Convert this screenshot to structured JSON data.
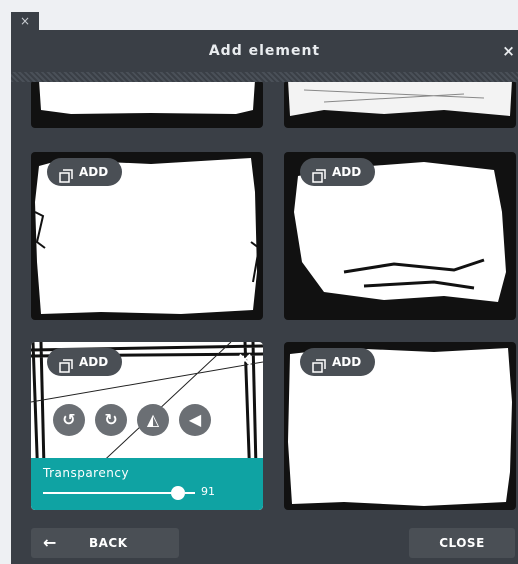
{
  "window": {
    "outer_close_icon": "×",
    "title": "Add element",
    "close_icon": "×"
  },
  "tiles": [
    {
      "add_label": "ADD"
    },
    {
      "add_label": "ADD"
    },
    {
      "add_label": "ADD",
      "selected": true,
      "close_icon": "✕"
    },
    {
      "add_label": "ADD"
    }
  ],
  "selected_tools": [
    {
      "icon": "rotate-left-icon",
      "glyph": "↺"
    },
    {
      "icon": "rotate-right-icon",
      "glyph": "↻"
    },
    {
      "icon": "flip-horizontal-icon",
      "glyph": "◭"
    },
    {
      "icon": "flip-vertical-icon",
      "glyph": "◀"
    }
  ],
  "transparency": {
    "label": "Transparency",
    "value": "91",
    "level": 0.91
  },
  "footer": {
    "back_arrow": "←",
    "back_label": "BACK",
    "close_label": "CLOSE"
  },
  "colors": {
    "panel": "#3a3f46",
    "accent": "#0fa3a3",
    "button": "#4a4f55"
  }
}
